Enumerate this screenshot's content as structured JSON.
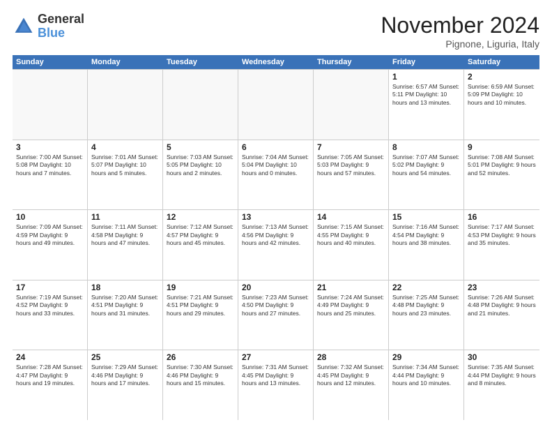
{
  "logo": {
    "general": "General",
    "blue": "Blue"
  },
  "title": "November 2024",
  "location": "Pignone, Liguria, Italy",
  "header_days": [
    "Sunday",
    "Monday",
    "Tuesday",
    "Wednesday",
    "Thursday",
    "Friday",
    "Saturday"
  ],
  "weeks": [
    [
      {
        "day": "",
        "info": "",
        "empty": true
      },
      {
        "day": "",
        "info": "",
        "empty": true
      },
      {
        "day": "",
        "info": "",
        "empty": true
      },
      {
        "day": "",
        "info": "",
        "empty": true
      },
      {
        "day": "",
        "info": "",
        "empty": true
      },
      {
        "day": "1",
        "info": "Sunrise: 6:57 AM\nSunset: 5:11 PM\nDaylight: 10 hours\nand 13 minutes."
      },
      {
        "day": "2",
        "info": "Sunrise: 6:59 AM\nSunset: 5:09 PM\nDaylight: 10 hours\nand 10 minutes."
      }
    ],
    [
      {
        "day": "3",
        "info": "Sunrise: 7:00 AM\nSunset: 5:08 PM\nDaylight: 10 hours\nand 7 minutes."
      },
      {
        "day": "4",
        "info": "Sunrise: 7:01 AM\nSunset: 5:07 PM\nDaylight: 10 hours\nand 5 minutes."
      },
      {
        "day": "5",
        "info": "Sunrise: 7:03 AM\nSunset: 5:05 PM\nDaylight: 10 hours\nand 2 minutes."
      },
      {
        "day": "6",
        "info": "Sunrise: 7:04 AM\nSunset: 5:04 PM\nDaylight: 10 hours\nand 0 minutes."
      },
      {
        "day": "7",
        "info": "Sunrise: 7:05 AM\nSunset: 5:03 PM\nDaylight: 9 hours\nand 57 minutes."
      },
      {
        "day": "8",
        "info": "Sunrise: 7:07 AM\nSunset: 5:02 PM\nDaylight: 9 hours\nand 54 minutes."
      },
      {
        "day": "9",
        "info": "Sunrise: 7:08 AM\nSunset: 5:01 PM\nDaylight: 9 hours\nand 52 minutes."
      }
    ],
    [
      {
        "day": "10",
        "info": "Sunrise: 7:09 AM\nSunset: 4:59 PM\nDaylight: 9 hours\nand 49 minutes."
      },
      {
        "day": "11",
        "info": "Sunrise: 7:11 AM\nSunset: 4:58 PM\nDaylight: 9 hours\nand 47 minutes."
      },
      {
        "day": "12",
        "info": "Sunrise: 7:12 AM\nSunset: 4:57 PM\nDaylight: 9 hours\nand 45 minutes."
      },
      {
        "day": "13",
        "info": "Sunrise: 7:13 AM\nSunset: 4:56 PM\nDaylight: 9 hours\nand 42 minutes."
      },
      {
        "day": "14",
        "info": "Sunrise: 7:15 AM\nSunset: 4:55 PM\nDaylight: 9 hours\nand 40 minutes."
      },
      {
        "day": "15",
        "info": "Sunrise: 7:16 AM\nSunset: 4:54 PM\nDaylight: 9 hours\nand 38 minutes."
      },
      {
        "day": "16",
        "info": "Sunrise: 7:17 AM\nSunset: 4:53 PM\nDaylight: 9 hours\nand 35 minutes."
      }
    ],
    [
      {
        "day": "17",
        "info": "Sunrise: 7:19 AM\nSunset: 4:52 PM\nDaylight: 9 hours\nand 33 minutes."
      },
      {
        "day": "18",
        "info": "Sunrise: 7:20 AM\nSunset: 4:51 PM\nDaylight: 9 hours\nand 31 minutes."
      },
      {
        "day": "19",
        "info": "Sunrise: 7:21 AM\nSunset: 4:51 PM\nDaylight: 9 hours\nand 29 minutes."
      },
      {
        "day": "20",
        "info": "Sunrise: 7:23 AM\nSunset: 4:50 PM\nDaylight: 9 hours\nand 27 minutes."
      },
      {
        "day": "21",
        "info": "Sunrise: 7:24 AM\nSunset: 4:49 PM\nDaylight: 9 hours\nand 25 minutes."
      },
      {
        "day": "22",
        "info": "Sunrise: 7:25 AM\nSunset: 4:48 PM\nDaylight: 9 hours\nand 23 minutes."
      },
      {
        "day": "23",
        "info": "Sunrise: 7:26 AM\nSunset: 4:48 PM\nDaylight: 9 hours\nand 21 minutes."
      }
    ],
    [
      {
        "day": "24",
        "info": "Sunrise: 7:28 AM\nSunset: 4:47 PM\nDaylight: 9 hours\nand 19 minutes."
      },
      {
        "day": "25",
        "info": "Sunrise: 7:29 AM\nSunset: 4:46 PM\nDaylight: 9 hours\nand 17 minutes."
      },
      {
        "day": "26",
        "info": "Sunrise: 7:30 AM\nSunset: 4:46 PM\nDaylight: 9 hours\nand 15 minutes."
      },
      {
        "day": "27",
        "info": "Sunrise: 7:31 AM\nSunset: 4:45 PM\nDaylight: 9 hours\nand 13 minutes."
      },
      {
        "day": "28",
        "info": "Sunrise: 7:32 AM\nSunset: 4:45 PM\nDaylight: 9 hours\nand 12 minutes."
      },
      {
        "day": "29",
        "info": "Sunrise: 7:34 AM\nSunset: 4:44 PM\nDaylight: 9 hours\nand 10 minutes."
      },
      {
        "day": "30",
        "info": "Sunrise: 7:35 AM\nSunset: 4:44 PM\nDaylight: 9 hours\nand 8 minutes."
      }
    ]
  ]
}
